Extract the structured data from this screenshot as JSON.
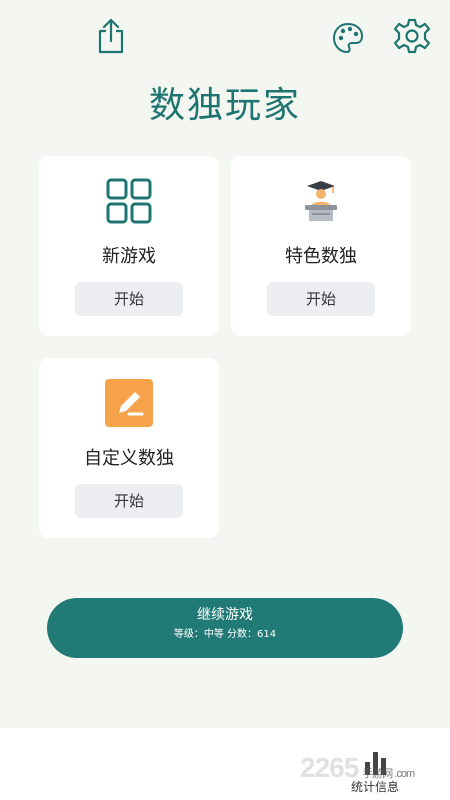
{
  "header": {
    "share_icon": "share-icon",
    "palette_icon": "palette-icon",
    "settings_icon": "gear-icon",
    "title": "数独玩家"
  },
  "cards": [
    {
      "label": "新游戏",
      "icon": "grid-icon",
      "button": "开始"
    },
    {
      "label": "特色数独",
      "icon": "graduate-icon",
      "button": "开始"
    },
    {
      "label": "自定义数独",
      "icon": "edit-icon",
      "button": "开始"
    }
  ],
  "continue": {
    "title": "继续游戏",
    "subtitle": "等级：中等 分数：614"
  },
  "bottom_nav": {
    "stats_label": "统计信息",
    "stats_icon": "bar-chart-icon"
  },
  "watermark": {
    "text": "2265",
    "site": "手游网 .com"
  },
  "colors": {
    "accent": "#1e7470",
    "background": "#f4f7f1",
    "edit_orange": "#f6a24a"
  }
}
